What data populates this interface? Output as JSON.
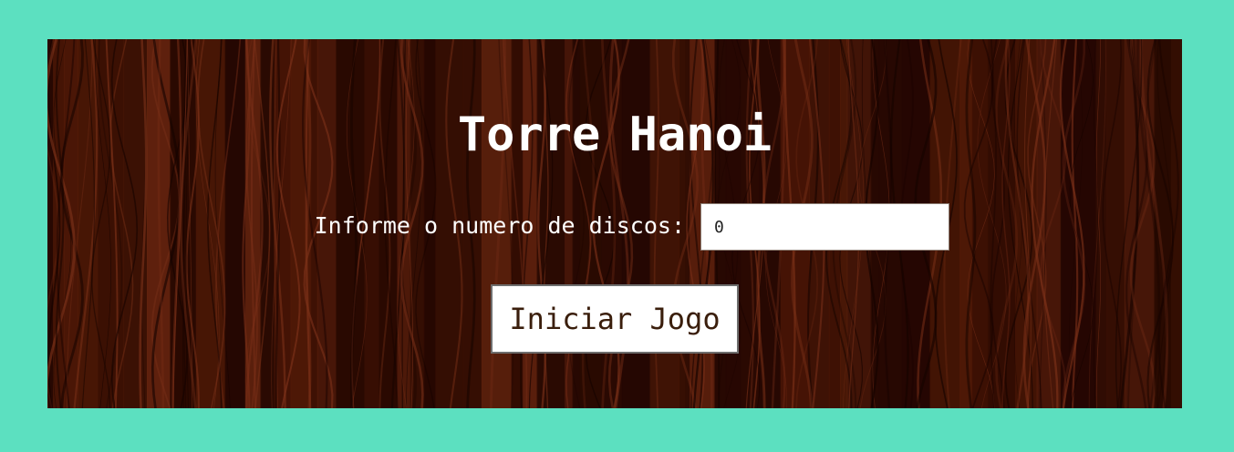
{
  "colors": {
    "page_background": "#5ce0c0",
    "board_dark": "#2a0a02",
    "board_mid": "#4a1606",
    "board_light": "#6a2610",
    "title_text": "#ffffff",
    "button_text": "#3a1e0c"
  },
  "game": {
    "title": "Torre Hanoi",
    "disc_label": "Informe o numero de discos:",
    "disc_input_value": "0",
    "start_button_label": "Iniciar Jogo"
  }
}
